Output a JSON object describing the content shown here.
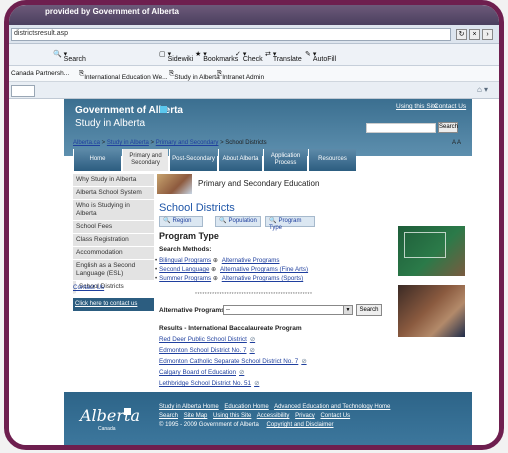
{
  "browser": {
    "title": "provided by Government of Alberta",
    "url": "districtsresult.asp",
    "toolbar": [
      "Search",
      "Sidewiki",
      "Bookmarks",
      "Check",
      "Translate",
      "AutoFill"
    ],
    "favorites": [
      "Canada Partnersh...",
      "International Education We...",
      "Study in Alberta",
      "Intranet Admin"
    ]
  },
  "header": {
    "org": "Government of Alberta",
    "site": "Study in Alberta",
    "links": [
      "Using this Site",
      "Contact Us"
    ],
    "search_button": "Search"
  },
  "breadcrumb": [
    "Alberta.ca",
    "Study in Alberta",
    "Primary and Secondary",
    "School Districts"
  ],
  "text_size": "A A",
  "nav": [
    "Home",
    "Primary and Secondary",
    "Post-Secondary",
    "About Alberta",
    "Application Process",
    "Resources"
  ],
  "sidebar": {
    "items": [
      "Why Study in Alberta",
      "Alberta School System",
      "Who is Studying in Alberta",
      "School Fees",
      "Class Registration",
      "Accommodation",
      "English as a Second Language (ESL)",
      "School Districts"
    ],
    "contact": "Contact Us",
    "click_here": "Click here to contact us"
  },
  "hero_title": "Primary and Secondary Education",
  "content": {
    "heading": "School Districts",
    "filters": [
      "Region",
      "Population",
      "Program Type"
    ],
    "subheading": "Program Type",
    "methods_label": "Search Methods:",
    "methods": [
      {
        "name": "Bilingual Programs",
        "links": [
          "Alternative Programs"
        ]
      },
      {
        "name": "Second Language",
        "links": [
          "Alternative Programs (Fine Arts)"
        ]
      },
      {
        "name": "Summer Programs",
        "links": [
          "Alternative Programs (Sports)"
        ]
      }
    ],
    "stars": "************************************************",
    "alt_label": "Alternative Programs:",
    "select_value": "--",
    "search_button": "Search",
    "results_title": "Results - International Baccalaureate Program",
    "results": [
      "Red Deer Public School District",
      "Edmonton School District No. 7",
      "Edmonton Catholic Separate School District No. 7",
      "Calgary Board of Education",
      "Lethbridge School District No. 51"
    ]
  },
  "footer": {
    "logo": "Alberta",
    "logo_sub": "Canada",
    "row1": [
      "Study in Alberta Home",
      "Education Home",
      "Advanced Education and Technology Home"
    ],
    "row2": [
      "Search",
      "Site Map",
      "Using this Site",
      "Accessibility",
      "Privacy",
      "Contact Us"
    ],
    "copyright": "© 1995 - 2009 Government of Alberta",
    "copyright_link": "Copyright and Disclaimer"
  }
}
